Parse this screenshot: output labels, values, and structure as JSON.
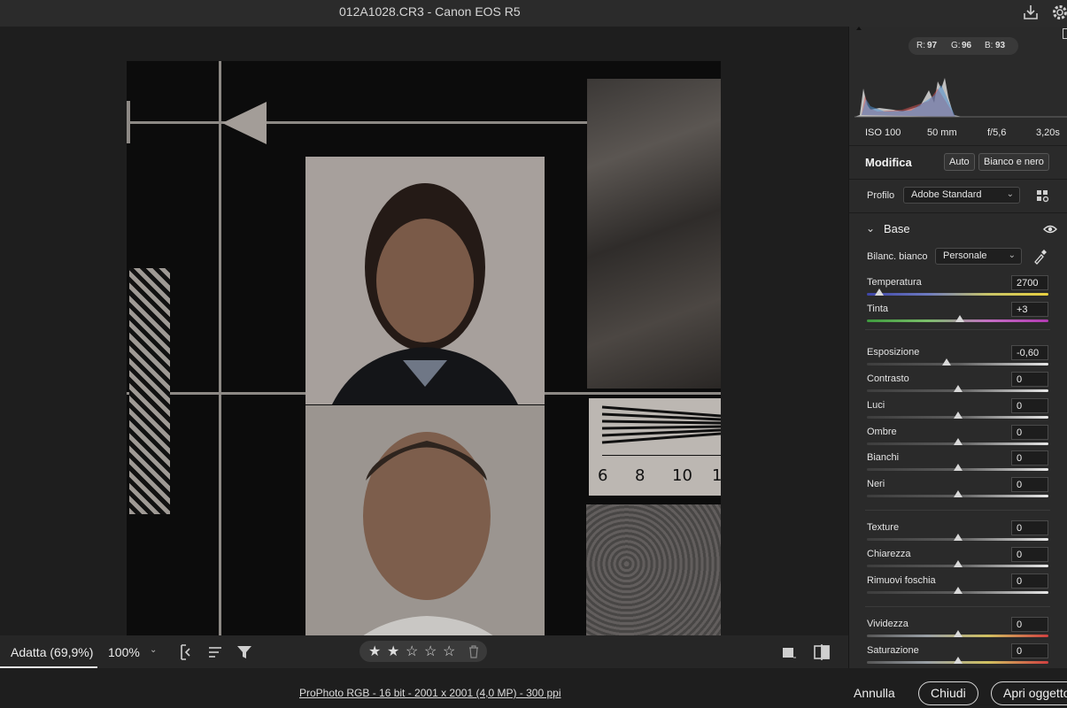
{
  "titlebar": {
    "title": "012A1028.CR3  -  Canon EOS R5"
  },
  "histogram": {
    "r_label": "R:",
    "r": "97",
    "g_label": "G:",
    "g": "96",
    "b_label": "B:",
    "b": "93"
  },
  "exif": {
    "iso": "ISO 100",
    "focal": "50 mm",
    "aperture": "f/5,6",
    "shutter": "3,20s"
  },
  "edit": {
    "title": "Modifica",
    "auto_btn": "Auto",
    "bw_btn": "Bianco e nero"
  },
  "profile": {
    "label": "Profilo",
    "value": "Adobe Standard"
  },
  "base": {
    "title": "Base",
    "wb_label": "Bilanc. bianco",
    "wb_value": "Personale",
    "sliders": [
      {
        "label": "Temperatura",
        "value": "2700",
        "pos": 0.07
      },
      {
        "label": "Tinta",
        "value": "+3",
        "pos": 0.51
      },
      {
        "label": "Esposizione",
        "value": "-0,60",
        "pos": 0.44
      },
      {
        "label": "Contrasto",
        "value": "0",
        "pos": 0.5
      },
      {
        "label": "Luci",
        "value": "0",
        "pos": 0.5
      },
      {
        "label": "Ombre",
        "value": "0",
        "pos": 0.5
      },
      {
        "label": "Bianchi",
        "value": "0",
        "pos": 0.5
      },
      {
        "label": "Neri",
        "value": "0",
        "pos": 0.5
      },
      {
        "label": "Texture",
        "value": "0",
        "pos": 0.5
      },
      {
        "label": "Chiarezza",
        "value": "0",
        "pos": 0.5
      },
      {
        "label": "Rimuovi foschia",
        "value": "0",
        "pos": 0.5
      },
      {
        "label": "Vividezza",
        "value": "0",
        "pos": 0.5
      },
      {
        "label": "Saturazione",
        "value": "0",
        "pos": 0.5
      }
    ]
  },
  "canvasbar": {
    "zoom_fit": "Adatta (69,9%)",
    "zoom_100": "100%"
  },
  "rating": {
    "stars_filled": 2,
    "stars_total": 5
  },
  "chart_marks": {
    "n6": "6",
    "n8": "8",
    "n10": "10",
    "n1": "1"
  },
  "footer": {
    "file_info": "ProPhoto RGB - 16 bit - 2001 x 2001 (4,0 MP) - 300 ppi",
    "cancel": "Annulla",
    "close": "Chiudi",
    "open": "Apri oggetto"
  }
}
